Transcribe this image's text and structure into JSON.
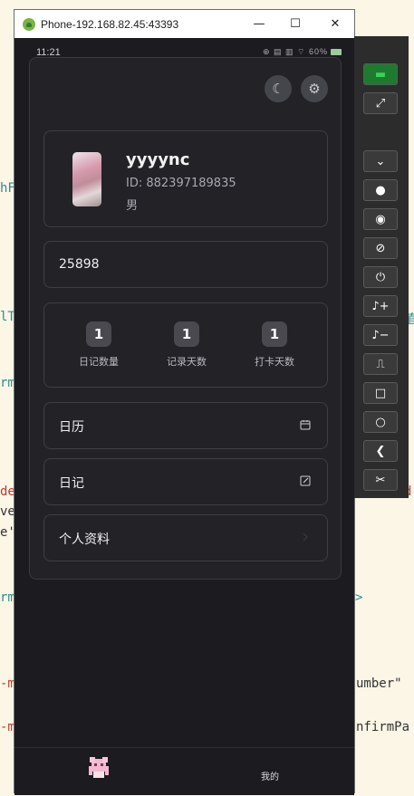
{
  "window": {
    "title": "Phone-192.168.82.45:43393",
    "minimize": "—",
    "maximize": "☐",
    "close": "✕"
  },
  "statusbar": {
    "time": "11:21",
    "icons": "⊕ ▤ ▥ ⌔ 60%"
  },
  "profile": {
    "username": "yyyync",
    "id": "ID: 882397189835",
    "gender": "男",
    "code": "25898"
  },
  "stats": [
    {
      "value": "1",
      "label": "日记数量"
    },
    {
      "value": "1",
      "label": "记录天数"
    },
    {
      "value": "1",
      "label": "打卡天数"
    }
  ],
  "menu": [
    {
      "label": "日历",
      "icon": "calendar-icon"
    },
    {
      "label": "日记",
      "icon": "edit-icon"
    },
    {
      "label": "个人资料",
      "icon": "chevron-right-icon"
    }
  ],
  "bottomnav": {
    "mine": "我的"
  },
  "background_code": {
    "l1": "hF",
    "l2": "lT",
    "l3": "rm",
    "l4": "de",
    "l5": "ve",
    "l6": "e'",
    "l7": "rm",
    "l8": "-m",
    "l9": "-m",
    "r1": "值",
    "r2": "d",
    "r3": ">",
    "r4": "umber\"",
    "r5": "nfirmPa"
  },
  "colors": {
    "app_bg": "#1c1b1f",
    "card_bg": "#232227",
    "border": "#3f3e44",
    "badge": "#4a4950"
  }
}
